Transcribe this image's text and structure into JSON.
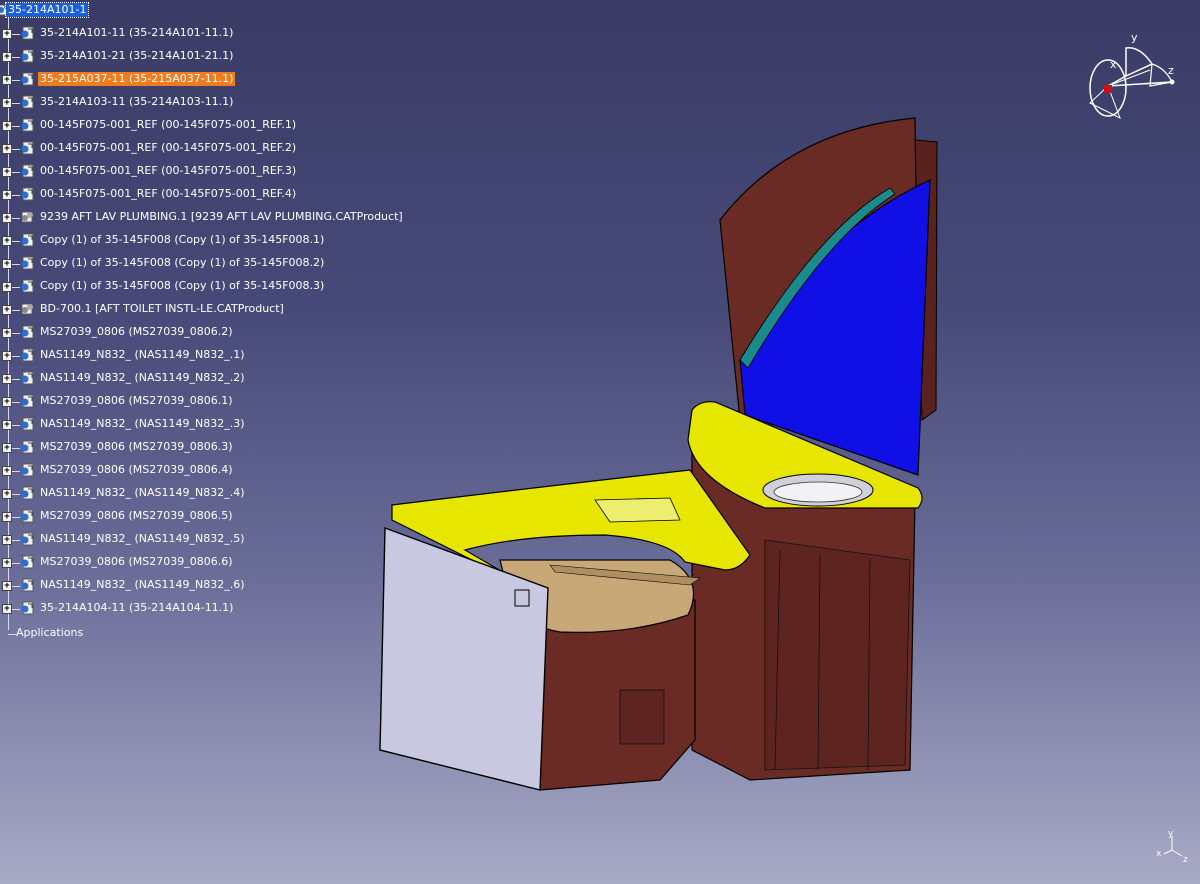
{
  "tree": {
    "root": "35-214A101-1",
    "items": [
      {
        "label": "35-214A101-11 (35-214A101-11.1)",
        "icon": "part-icon",
        "state": "normal"
      },
      {
        "label": "35-214A101-21 (35-214A101-21.1)",
        "icon": "part-icon",
        "state": "normal"
      },
      {
        "label": "35-215A037-11 (35-215A037-11.1)",
        "icon": "part-icon",
        "state": "selected"
      },
      {
        "label": "35-214A103-11 (35-214A103-11.1)",
        "icon": "part-icon",
        "state": "normal"
      },
      {
        "label": "00-145F075-001_REF (00-145F075-001_REF.1)",
        "icon": "part-icon",
        "state": "normal"
      },
      {
        "label": "00-145F075-001_REF (00-145F075-001_REF.2)",
        "icon": "part-icon",
        "state": "normal"
      },
      {
        "label": "00-145F075-001_REF (00-145F075-001_REF.3)",
        "icon": "part-icon",
        "state": "normal"
      },
      {
        "label": "00-145F075-001_REF (00-145F075-001_REF.4)",
        "icon": "part-icon",
        "state": "normal"
      },
      {
        "label": "9239 AFT LAV PLUMBING.1 [9239 AFT LAV PLUMBING.CATProduct]",
        "icon": "product-icon",
        "state": "normal"
      },
      {
        "label": "Copy (1) of 35-145F008 (Copy (1) of 35-145F008.1)",
        "icon": "part-icon",
        "state": "normal"
      },
      {
        "label": "Copy (1) of 35-145F008 (Copy (1) of 35-145F008.2)",
        "icon": "part-icon",
        "state": "normal"
      },
      {
        "label": "Copy (1) of 35-145F008 (Copy (1) of 35-145F008.3)",
        "icon": "part-icon",
        "state": "normal"
      },
      {
        "label": "BD-700.1 [AFT TOILET INSTL-LE.CATProduct]",
        "icon": "product-icon",
        "state": "normal"
      },
      {
        "label": "MS27039_0806 (MS27039_0806.2)",
        "icon": "part-icon",
        "state": "normal"
      },
      {
        "label": "NAS1149_N832_ (NAS1149_N832_.1)",
        "icon": "part-icon",
        "state": "normal"
      },
      {
        "label": "NAS1149_N832_ (NAS1149_N832_.2)",
        "icon": "part-icon",
        "state": "normal"
      },
      {
        "label": "MS27039_0806 (MS27039_0806.1)",
        "icon": "part-icon",
        "state": "normal"
      },
      {
        "label": "NAS1149_N832_ (NAS1149_N832_.3)",
        "icon": "part-icon",
        "state": "normal"
      },
      {
        "label": "MS27039_0806 (MS27039_0806.3)",
        "icon": "part-icon",
        "state": "normal"
      },
      {
        "label": "MS27039_0806 (MS27039_0806.4)",
        "icon": "part-icon",
        "state": "normal"
      },
      {
        "label": "NAS1149_N832_ (NAS1149_N832_.4)",
        "icon": "part-icon",
        "state": "normal"
      },
      {
        "label": "MS27039_0806 (MS27039_0806.5)",
        "icon": "part-icon",
        "state": "normal"
      },
      {
        "label": "NAS1149_N832_ (NAS1149_N832_.5)",
        "icon": "part-icon",
        "state": "normal"
      },
      {
        "label": "MS27039_0806 (MS27039_0806.6)",
        "icon": "part-icon",
        "state": "normal"
      },
      {
        "label": "NAS1149_N832_ (NAS1149_N832_.6)",
        "icon": "part-icon",
        "state": "normal"
      },
      {
        "label": "35-214A104-11 (35-214A104-11.1)",
        "icon": "part-icon",
        "state": "normal"
      }
    ],
    "applications": "Applications"
  },
  "compass": {
    "x": "x",
    "y": "y",
    "z": "z"
  },
  "axis_mini": {
    "x": "x",
    "y": "y",
    "z": "z"
  },
  "colors": {
    "selection_root": "#1a5fd6",
    "selection_item": "#f07c1e",
    "cabinet": "#6b2b25",
    "countertop": "#e6e600",
    "mirror": "#1010e6",
    "door": "#c8c8e0"
  }
}
